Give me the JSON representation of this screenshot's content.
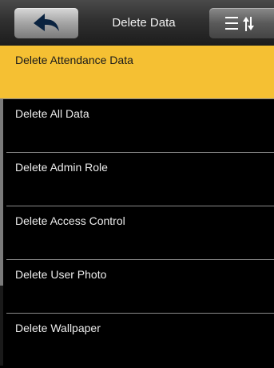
{
  "header": {
    "title": "Delete Data"
  },
  "menu_items": [
    "Delete Attendance Data",
    "Delete All Data",
    "Delete Admin Role",
    "Delete Access Control",
    "Delete User Photo",
    "Delete Wallpaper"
  ],
  "selected_index": 0,
  "colors": {
    "selected_bg": "#f5c033",
    "background": "#000000",
    "divider": "#8a8a8a",
    "text": "#ececec"
  },
  "icons": {
    "back": "back-arrow-icon",
    "menu": "sort-menu-icon"
  }
}
